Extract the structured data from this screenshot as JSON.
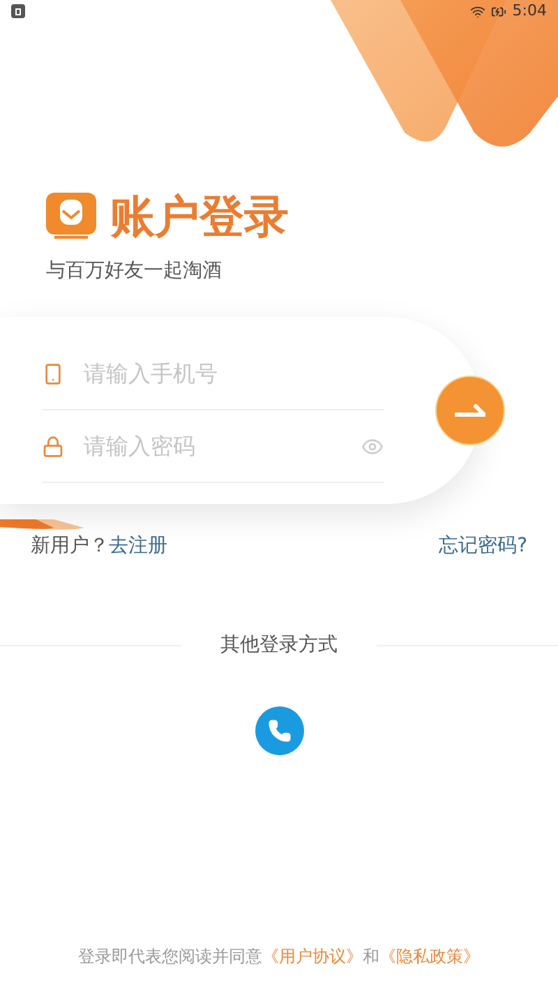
{
  "status_bar": {
    "time": "5:04"
  },
  "header": {
    "title": "账户登录",
    "subtitle": "与百万好友一起淘酒"
  },
  "form": {
    "fields": [
      {
        "kind": "phone",
        "placeholder": "请输入手机号"
      },
      {
        "kind": "password",
        "placeholder": "请输入密码"
      }
    ]
  },
  "links": {
    "register_prefix": "新用户？",
    "register": "去注册",
    "forgot": "忘记密码?"
  },
  "other_login": {
    "label": "其他登录方式"
  },
  "agreement": {
    "text": "登录即代表您阅读并同意",
    "user_agreement": "《用户协议》",
    "conjunction": "和",
    "privacy_policy": "《隐私政策》"
  }
}
